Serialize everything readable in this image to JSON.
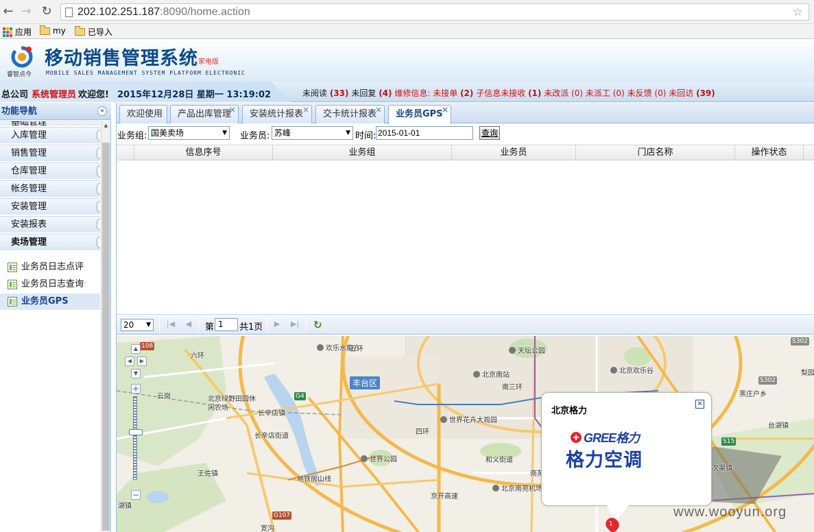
{
  "browser": {
    "url_host": "202.102.251.187",
    "url_rest": ":8090/home.action",
    "bookmarks": [
      "应用",
      "my",
      "已导入"
    ]
  },
  "header": {
    "logo_caption": "睿智点今",
    "title": "移动销售管理系统",
    "title_badge": "家电版",
    "subtitle": "MOBILE SALES MANAGEMENT SYSTEM PLATFORM ELECTRONIC"
  },
  "status": {
    "company": "总公司",
    "role": "系统管理员",
    "welcome": "欢迎您!",
    "datetime": "2015年12月28日 星期一 13:19:02",
    "unread_label": "未阅读",
    "unread": "(33)",
    "unreplied_label": "未回复",
    "unreplied": "(4)",
    "repair_label": "维修信息:",
    "unaccepted_label": "未接单",
    "unaccepted": "(2)",
    "subinfo_label": "子信息未接收",
    "subinfo": "(1)",
    "unchanged_label": "未改派",
    "unchanged": "(0)",
    "undispatched_label": "未派工",
    "undispatched": "(0)",
    "unfeedback_label": "未反馈",
    "unfeedback": "(0)",
    "unvisited_label": "未回访",
    "unvisited": "(39)"
  },
  "sidebar": {
    "title": "功能导航",
    "partial_item": "基础管理",
    "menu": [
      "入库管理",
      "销售管理",
      "仓库管理",
      "帐务管理",
      "安装管理",
      "安装报表",
      "卖场管理"
    ],
    "sub_items": [
      "业务员日志点评",
      "业务员日志查询",
      "业务员GPS"
    ]
  },
  "tabs": [
    "欢迎使用",
    "产品出库管理",
    "安装统计报表",
    "交卡统计报表",
    "业务员GPS"
  ],
  "filters": {
    "group_label": "业务组:",
    "group_value": "国美卖场",
    "staff_label": "业务员:",
    "staff_value": "苏峰",
    "time_label": "时间:",
    "time_value": "2015-01-01",
    "query_button": "查询"
  },
  "grid": {
    "columns": [
      "信息序号",
      "业务组",
      "业务员",
      "门店名称",
      "操作状态"
    ]
  },
  "pager": {
    "page_size": "20",
    "page_prefix": "第",
    "page_value": "1",
    "page_total": "共1页"
  },
  "map": {
    "labels": [
      "欢乐水魔方",
      "天坛公园",
      "北京南站",
      "北京欢乐谷",
      "丰台区",
      "云岗",
      "北京绿野田园休闲农场",
      "长辛店镇",
      "长辛店街道",
      "世界花卉大观园",
      "世界公园",
      "和义街道",
      "王佐镇",
      "北京南苑机场",
      "黑庄户乡",
      "台湖镇",
      "湖镇",
      "次渠镇",
      "四环",
      "五环",
      "六环",
      "南三环",
      "地铁房山线",
      "京开高速",
      "南苑",
      "梨园",
      "宽沟"
    ],
    "shields": [
      "108",
      "G4",
      "S302",
      "S302",
      "S15",
      "G107"
    ],
    "info_title": "北京格力",
    "brand_en": "GREE格力",
    "brand_cn": "格力空调",
    "marker_number": "1"
  },
  "watermark": "www.wooyun.org"
}
